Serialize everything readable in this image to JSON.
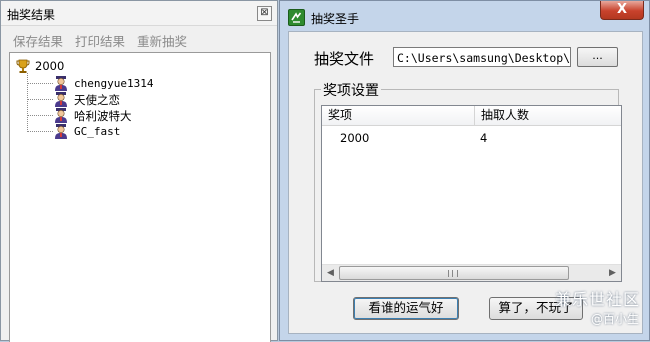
{
  "results_window": {
    "title": "抽奖结果",
    "close_glyph": "⊠",
    "menu": [
      "保存结果",
      "打印结果",
      "重新抽奖"
    ],
    "tree": {
      "root": {
        "label": "2000",
        "icon": "trophy-icon"
      },
      "children": [
        {
          "label": "chengyue1314",
          "icon": "user-icon"
        },
        {
          "label": "天使之恋",
          "icon": "user-icon"
        },
        {
          "label": "哈利波特大",
          "icon": "user-icon"
        },
        {
          "label": "GC_fast",
          "icon": "user-icon"
        }
      ]
    }
  },
  "main_window": {
    "title": "抽奖圣手",
    "close_glyph": "X",
    "file_label": "抽奖文件",
    "file_path": "C:\\Users\\samsung\\Desktop\\版块",
    "browse_label": "...",
    "prize_group_title": "奖项设置",
    "columns": [
      "奖项",
      "抽取人数"
    ],
    "rows": [
      {
        "prize": "2000",
        "count": "4"
      }
    ],
    "start_button": "看谁的运气好",
    "quit_button": "算了，不玩了"
  },
  "watermark": {
    "text": "兼乐世社区",
    "sub": "@百小生"
  },
  "colors": {
    "desktop": "#b9c9dc",
    "close_red": "#c8422c",
    "app_icon_green": "#2e8b2e"
  }
}
